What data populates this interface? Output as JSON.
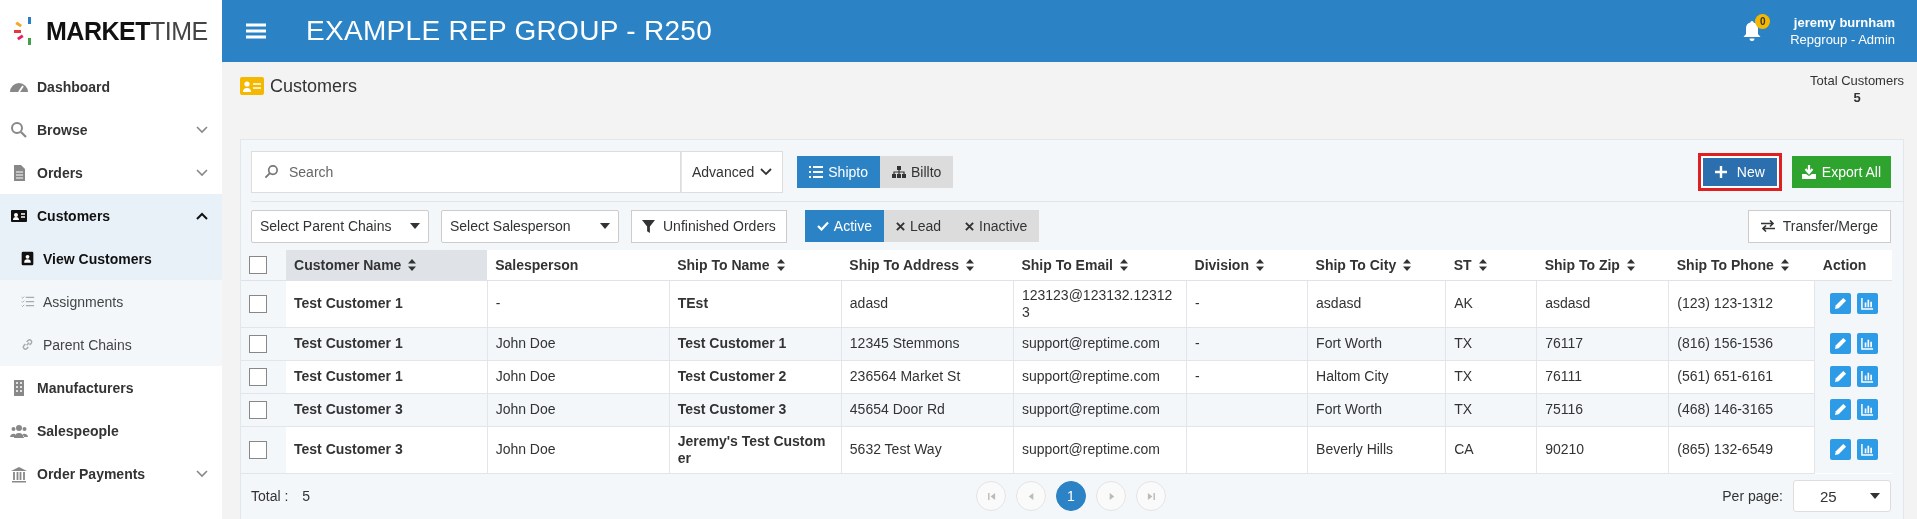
{
  "header": {
    "logo": {
      "part_1": "MARKET",
      "part_2": "TIME"
    },
    "title": "EXAMPLE REP GROUP - R250",
    "notifications": "0",
    "user": {
      "name": "jeremy burnham",
      "role": "Repgroup - Admin"
    }
  },
  "sidebar": {
    "items": [
      {
        "label": "Dashboard",
        "selected": false
      },
      {
        "label": "Browse",
        "selected": false,
        "expanded": false
      },
      {
        "label": "Orders",
        "selected": false,
        "expanded": false
      },
      {
        "label": "Customers",
        "selected": true,
        "expanded": true,
        "children": [
          {
            "label": "View Customers",
            "selected": true
          },
          {
            "label": "Assignments",
            "selected": false
          },
          {
            "label": "Parent Chains",
            "selected": false
          }
        ]
      },
      {
        "label": "Manufacturers",
        "selected": false
      },
      {
        "label": "Salespeople",
        "selected": false
      },
      {
        "label": "Order Payments",
        "selected": false,
        "expanded": false
      }
    ]
  },
  "page": {
    "title": "Customers",
    "total_label": "Total Customers",
    "total_value": "5"
  },
  "toolbar": {
    "search": {
      "placeholder": "Search"
    },
    "advanced": "Advanced",
    "view_tabs": [
      {
        "label": "Shipto",
        "selected": true
      },
      {
        "label": "Billto",
        "selected": false
      }
    ],
    "new_button": {
      "label": "New",
      "highlighted": true
    },
    "export_button": "Export All"
  },
  "filters": {
    "dropdowns": [
      "Select Parent Chains",
      "Select Salesperson"
    ],
    "unfinished": "Unfinished Orders",
    "status": [
      {
        "label": "Active",
        "selected": true
      },
      {
        "label": "Lead",
        "selected": false
      },
      {
        "label": "Inactive",
        "selected": false
      }
    ],
    "transfer": "Transfer/Merge"
  },
  "table": {
    "select_all_checked": false,
    "columns": [
      {
        "label": "Customer Name",
        "kind": "name",
        "sortable": true,
        "sorted": true
      },
      {
        "label": "Salesperson",
        "kind": "text",
        "sortable": false,
        "sorted": false
      },
      {
        "label": "Ship To Name",
        "kind": "name",
        "sortable": true,
        "sorted": false
      },
      {
        "label": "Ship To Address",
        "kind": "text",
        "sortable": true,
        "sorted": false
      },
      {
        "label": "Ship To Email",
        "kind": "text",
        "sortable": true,
        "sorted": false
      },
      {
        "label": "Division",
        "kind": "text",
        "sortable": true,
        "sorted": false
      },
      {
        "label": "Ship To City",
        "kind": "text",
        "sortable": true,
        "sorted": false
      },
      {
        "label": "ST",
        "kind": "text",
        "sortable": true,
        "sorted": false
      },
      {
        "label": "Ship To Zip",
        "kind": "text",
        "sortable": true,
        "sorted": false
      },
      {
        "label": "Ship To Phone",
        "kind": "text",
        "sortable": true,
        "sorted": false
      }
    ],
    "action_label": "Action",
    "rows": [
      {
        "checked": false,
        "cells": [
          "Test Customer 1",
          "-",
          "TEst",
          "adasd",
          "123123@123132.123123",
          "-",
          "asdasd",
          "AK",
          "asdasd",
          "(123) 123-1312"
        ]
      },
      {
        "checked": false,
        "cells": [
          "Test Customer 1",
          "John Doe",
          "Test Customer 1",
          "12345 Stemmons",
          "support@reptime.com",
          "-",
          "Fort Worth",
          "TX",
          "76117",
          "(816) 156-1536"
        ]
      },
      {
        "checked": false,
        "cells": [
          "Test Customer 1",
          "John Doe",
          "Test Customer 2",
          "236564 Market St",
          "support@reptime.com",
          "-",
          "Haltom City",
          "TX",
          "76111",
          "(561) 651-6161"
        ]
      },
      {
        "checked": false,
        "cells": [
          "Test Customer 3",
          "John Doe",
          "Test Customer 3",
          "45654 Door Rd",
          "support@reptime.com",
          null,
          "Fort Worth",
          "TX",
          "75116",
          "(468) 146-3165"
        ]
      },
      {
        "checked": false,
        "cells": [
          "Test Customer 3",
          "John Doe",
          "Jeremy's Test Customer",
          "5632 Test Way",
          "support@reptime.com",
          null,
          "Beverly Hills",
          "CA",
          "90210",
          "(865) 132-6549"
        ]
      }
    ]
  },
  "footer": {
    "total_label": "Total :",
    "total_value": "5",
    "pages": [
      {
        "label": "1",
        "selected": true
      }
    ],
    "per_page_label": "Per page:",
    "per_page_value": "25"
  }
}
